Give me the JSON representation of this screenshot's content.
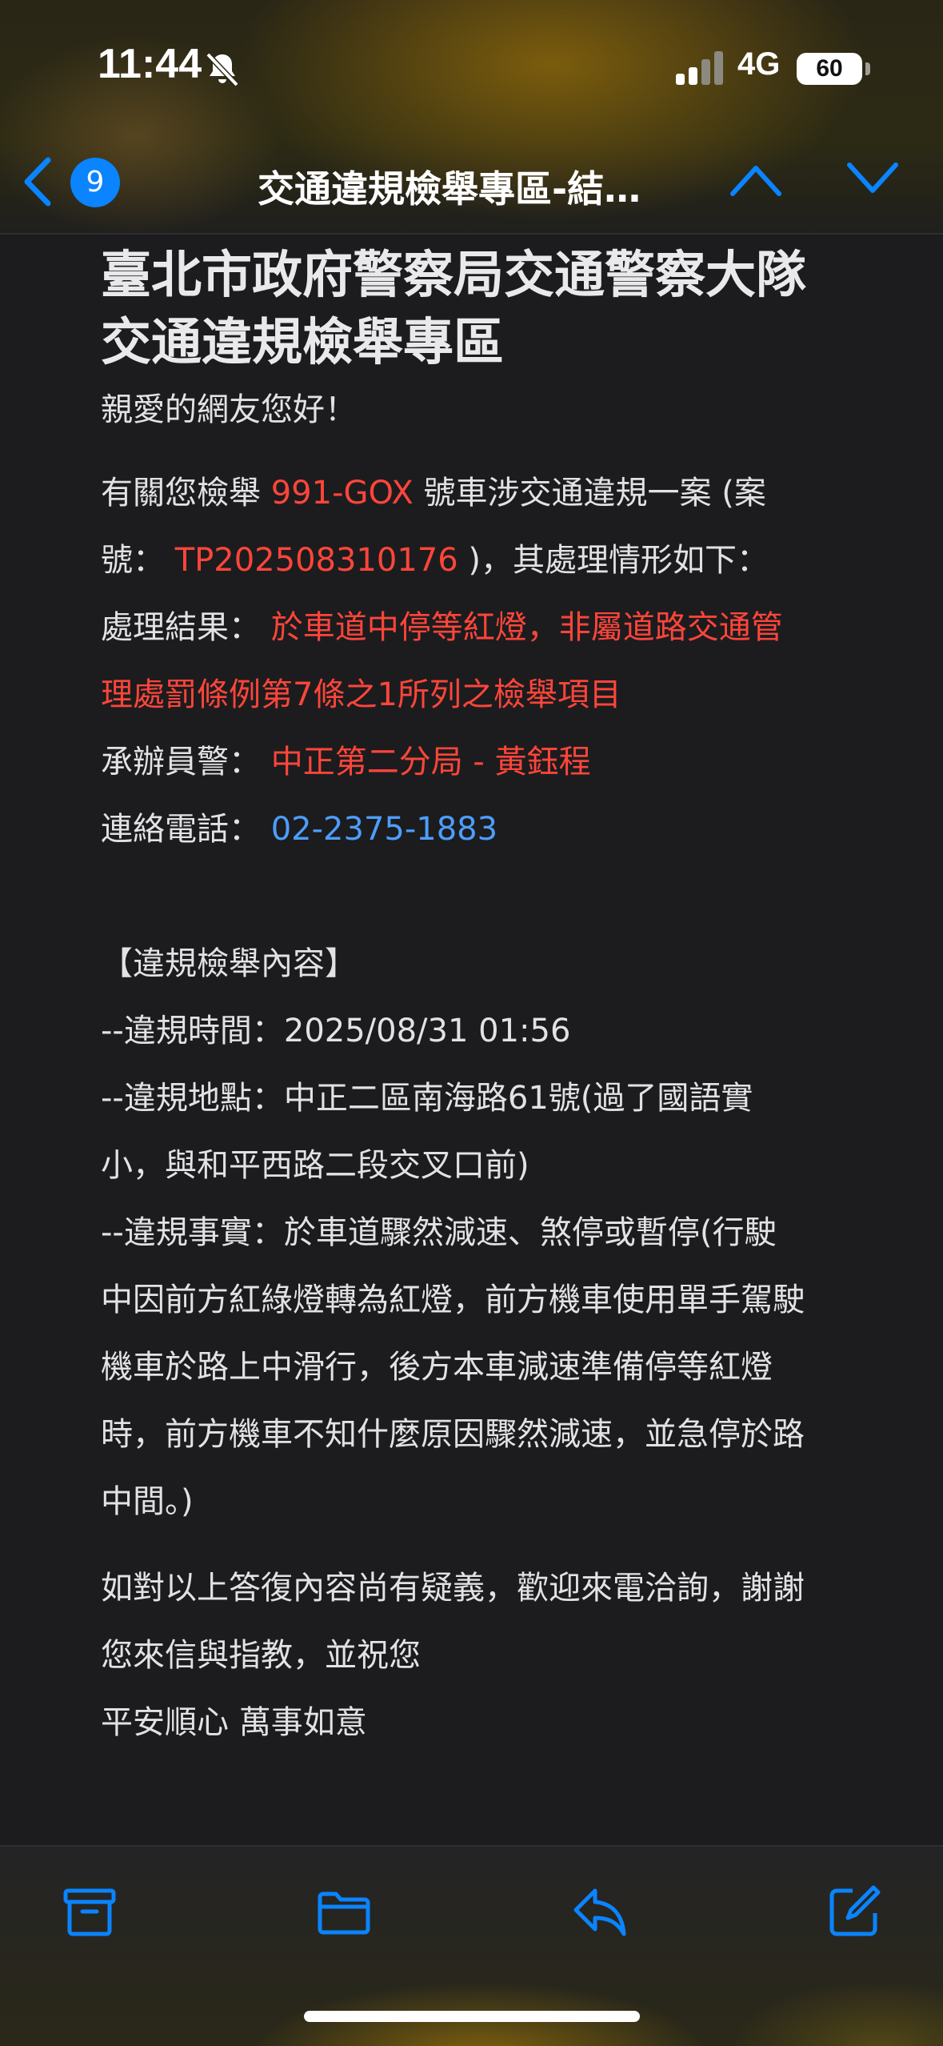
{
  "status_bar": {
    "time": "11:44",
    "network": "4G",
    "battery": "60"
  },
  "nav": {
    "unread_count": "9",
    "title": "交通違規檢舉專區-結…"
  },
  "email": {
    "heading_line1": "臺北市政府警察局交通警察大隊",
    "heading_line2": "交通違規檢舉專區",
    "greeting": "親愛的網友您好！",
    "intro_prefix": "有關您檢舉 ",
    "plate": "991-GOX",
    "intro_mid": " 號車涉交通違規一案 (案",
    "case_prefix": "號： ",
    "case_number": "TP202508310176",
    "case_suffix": " )，其處理情形如下：",
    "result_label": "處理結果： ",
    "result_line1": "於車道中停等紅燈，非屬道路交通管",
    "result_line2": "理處罰條例第7條之1所列之檢舉項目",
    "officer_label": "承辦員警： ",
    "officer": "中正第二分局 - 黃鈺程",
    "phone_label": "連絡電話： ",
    "phone": "02-2375-1883",
    "section_title": "【違規檢舉內容】",
    "time_line": "--違規時間：2025/08/31 01:56",
    "location_line1": "--違規地點：中正二區南海路61號(過了國語實",
    "location_line2": "小，與和平西路二段交叉口前)",
    "fact_line1": "--違規事實：於車道驟然減速、煞停或暫停(行駛",
    "fact_line2": "中因前方紅綠燈轉為紅燈，前方機車使用單手駕駛",
    "fact_line3": "機車於路上中滑行，後方本車減速準備停等紅燈",
    "fact_line4": "時，前方機車不知什麼原因驟然減速，並急停於路",
    "fact_line5": "中間。)",
    "closing_line1": "如對以上答復內容尚有疑義，歡迎來電洽詢，謝謝",
    "closing_line2": "您來信與指教，並祝您",
    "closing_line3": "平安順心 萬事如意"
  },
  "toolbar": {
    "icons": [
      "archive-icon",
      "folder-icon",
      "reply-icon",
      "compose-icon"
    ]
  },
  "colors": {
    "accent": "#0a84ff",
    "highlight_red": "#ff453a",
    "link_blue": "#4c9eff",
    "background": "#1c1c1e"
  }
}
